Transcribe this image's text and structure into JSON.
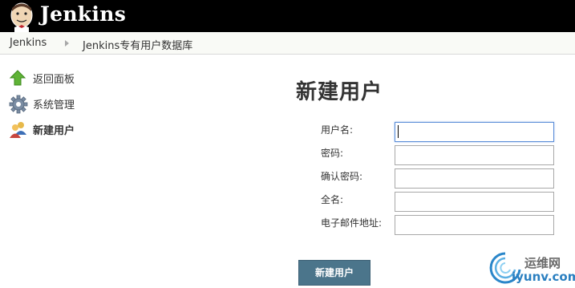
{
  "header": {
    "logo_text": "Jenkins"
  },
  "breadcrumb": {
    "home": "Jenkins",
    "current": "Jenkins专有用户数据库"
  },
  "sidebar": {
    "items": [
      {
        "label": "返回面板",
        "icon": "up-arrow-icon",
        "active": false
      },
      {
        "label": "系统管理",
        "icon": "gear-icon",
        "active": false
      },
      {
        "label": "新建用户",
        "icon": "users-icon",
        "active": true
      }
    ]
  },
  "form": {
    "title": "新建用户",
    "fields": [
      {
        "label": "用户名:",
        "value": "",
        "focused": true
      },
      {
        "label": "密码:",
        "value": ""
      },
      {
        "label": "确认密码:",
        "value": ""
      },
      {
        "label": "全名:",
        "value": ""
      },
      {
        "label": "电子邮件地址:",
        "value": ""
      }
    ],
    "submit_label": "新建用户"
  },
  "watermark": {
    "cn": "运维网",
    "en": "iyunv.com"
  },
  "colors": {
    "header_bg": "#000000",
    "button_bg": "#4b758b",
    "focus_border": "#5b8dd8"
  }
}
